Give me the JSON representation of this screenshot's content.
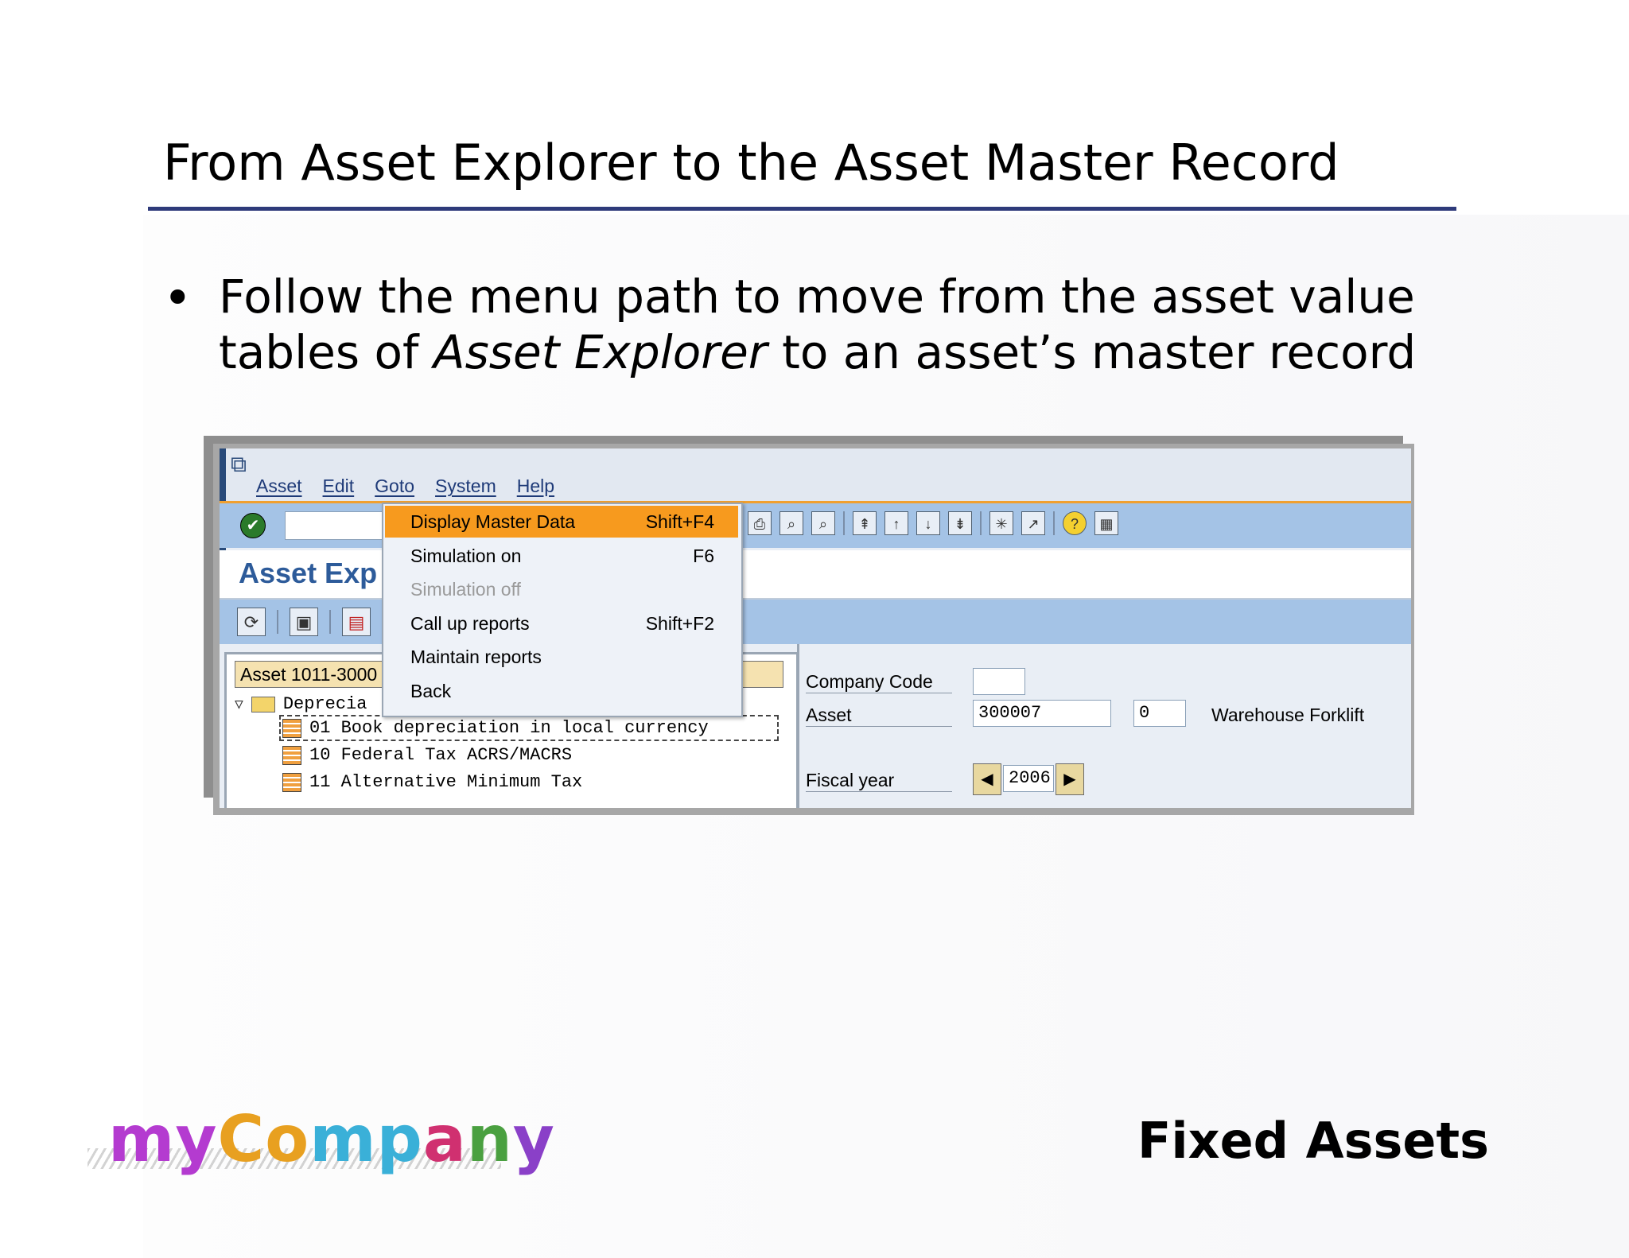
{
  "slide": {
    "title": "From Asset Explorer to the Asset Master Record",
    "bullet_part1": "Follow the menu path to move from the asset value tables of ",
    "bullet_italic": "Asset Explorer",
    "bullet_part2": " to an asset’s master record",
    "footer": "Fixed Assets",
    "logo_text": "myCompany",
    "logo_colors": [
      "#b43bd0",
      "#b43bd0",
      "#e8a020",
      "#e8a020",
      "#3ab0d8",
      "#3ab0d8",
      "#d03070",
      "#4aa040",
      "#8a40c8"
    ]
  },
  "sap": {
    "menu": [
      "Asset",
      "Edit",
      "Goto",
      "System",
      "Help"
    ],
    "title": "Asset Exp",
    "dropdown": [
      {
        "label": "Display Master Data",
        "key": "Shift+F4",
        "state": "active"
      },
      {
        "label": "Simulation on",
        "key": "F6",
        "state": "normal"
      },
      {
        "label": "Simulation off",
        "key": "",
        "state": "disabled"
      },
      {
        "label": "Call up reports",
        "key": "Shift+F2",
        "state": "normal"
      },
      {
        "label": "Maintain reports",
        "key": "",
        "state": "normal"
      },
      {
        "label": "Back",
        "key": "",
        "state": "normal"
      }
    ],
    "tree": {
      "header": "Asset 1011-3000",
      "folder": "Deprecia",
      "rows": [
        "01 Book depreciation in local currency",
        "10 Federal Tax ACRS/MACRS",
        "11 Alternative Minimum Tax"
      ]
    },
    "fields": {
      "company_code_label": "Company Code",
      "company_code_value": "",
      "asset_label": "Asset",
      "asset_value": "300007",
      "asset_sub": "0",
      "asset_desc": "Warehouse Forklift",
      "fiscal_year_label": "Fiscal year",
      "fiscal_year_value": "2006"
    }
  }
}
